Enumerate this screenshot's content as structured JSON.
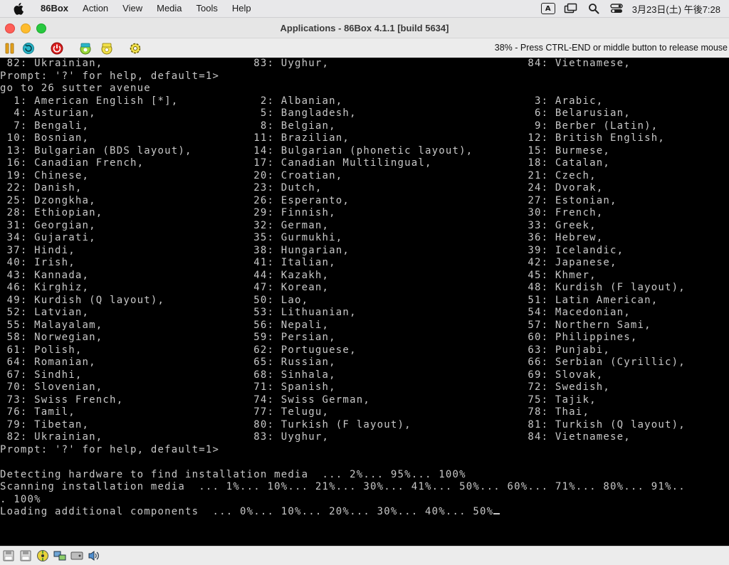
{
  "menubar": {
    "app_name": "86Box",
    "items": [
      "Action",
      "View",
      "Media",
      "Tools",
      "Help"
    ],
    "clock": "3月23日(土) 午後7:28",
    "input_source": "A"
  },
  "window": {
    "title": "Applications - 86Box 4.1.1 [build 5634]",
    "status_message": "38% - Press CTRL-END or middle button to release mouse"
  },
  "terminal": {
    "lines": [
      " 82: Ukrainian,                      83: Uyghur,                             84: Vietnamese,",
      "Prompt: '?' for help, default=1>",
      "go to 26 sutter avenue",
      "  1: American English [*],            2: Albanian,                            3: Arabic,",
      "  4: Asturian,                        5: Bangladesh,                          6: Belarusian,",
      "  7: Bengali,                         8: Belgian,                             9: Berber (Latin),",
      " 10: Bosnian,                        11: Brazilian,                          12: British English,",
      " 13: Bulgarian (BDS layout),         14: Bulgarian (phonetic layout),        15: Burmese,",
      " 16: Canadian French,                17: Canadian Multilingual,              18: Catalan,",
      " 19: Chinese,                        20: Croatian,                           21: Czech,",
      " 22: Danish,                         23: Dutch,                              24: Dvorak,",
      " 25: Dzongkha,                       26: Esperanto,                          27: Estonian,",
      " 28: Ethiopian,                      29: Finnish,                            30: French,",
      " 31: Georgian,                       32: German,                             33: Greek,",
      " 34: Gujarati,                       35: Gurmukhi,                           36: Hebrew,",
      " 37: Hindi,                          38: Hungarian,                          39: Icelandic,",
      " 40: Irish,                          41: Italian,                            42: Japanese,",
      " 43: Kannada,                        44: Kazakh,                             45: Khmer,",
      " 46: Kirghiz,                        47: Korean,                             48: Kurdish (F layout),",
      " 49: Kurdish (Q layout),             50: Lao,                                51: Latin American,",
      " 52: Latvian,                        53: Lithuanian,                         54: Macedonian,",
      " 55: Malayalam,                      56: Nepali,                             57: Northern Sami,",
      " 58: Norwegian,                      59: Persian,                            60: Philippines,",
      " 61: Polish,                         62: Portuguese,                         63: Punjabi,",
      " 64: Romanian,                       65: Russian,                            66: Serbian (Cyrillic),",
      " 67: Sindhi,                         68: Sinhala,                            69: Slovak,",
      " 70: Slovenian,                      71: Spanish,                            72: Swedish,",
      " 73: Swiss French,                   74: Swiss German,                       75: Tajik,",
      " 76: Tamil,                          77: Telugu,                             78: Thai,",
      " 79: Tibetan,                        80: Turkish (F layout),                 81: Turkish (Q layout),",
      " 82: Ukrainian,                      83: Uyghur,                             84: Vietnamese,",
      "Prompt: '?' for help, default=1>",
      "",
      "Detecting hardware to find installation media  ... 2%... 95%... 100%",
      "Scanning installation media  ... 1%... 10%... 21%... 30%... 41%... 50%... 60%... 71%... 80%... 91%..",
      ". 100%",
      "Loading additional components  ... 0%... 10%... 20%... 30%... 40%... 50%"
    ]
  }
}
